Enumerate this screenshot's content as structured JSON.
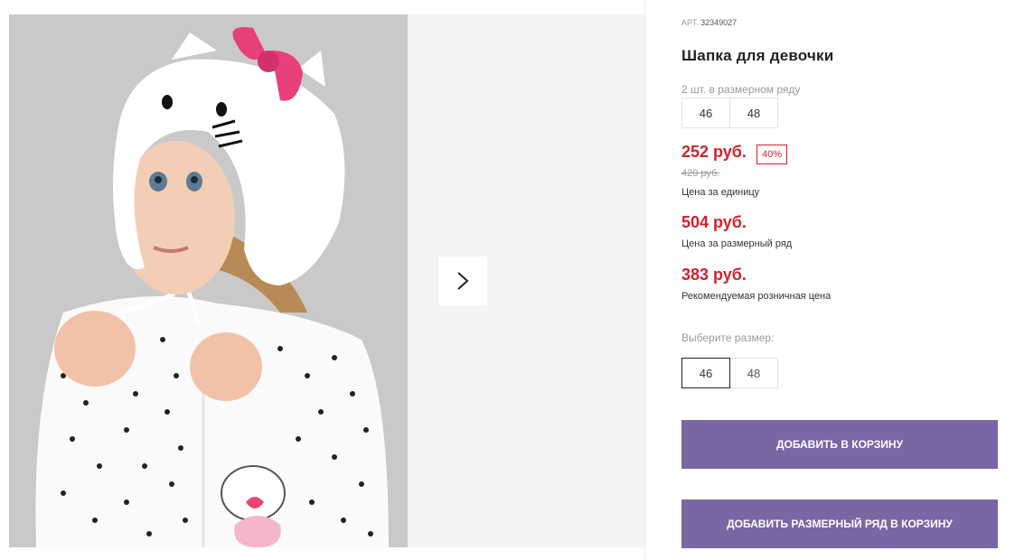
{
  "product": {
    "sku_label": "АРТ.",
    "sku_value": "32349027",
    "title": "Шапка для девочки"
  },
  "pack": {
    "caption": "2 шт. в размерном ряду",
    "sizes": [
      "46",
      "48"
    ]
  },
  "pricing": {
    "unit_price": "252 руб.",
    "discount": "40%",
    "old_price": "420 руб.",
    "unit_caption": "Цена за единицу",
    "row_price": "504 руб.",
    "row_caption": "Цена за размерный ряд",
    "retail_price": "383 руб.",
    "retail_caption": "Рекомендуемая розничная цена"
  },
  "size_select": {
    "label": "Выберите размер:",
    "options": [
      "46",
      "48"
    ],
    "selected": "46"
  },
  "actions": {
    "add_to_cart": "ДОБАВИТЬ В КОРЗИНУ",
    "add_row_to_cart": "ДОБАВИТЬ РАЗМЕРНЫЙ РЯД В КОРЗИНУ"
  },
  "gallery": {
    "next_icon": "chevron-right-icon"
  },
  "colors": {
    "price_red": "#d0232e",
    "button_purple": "#7a66a3",
    "photo_backdrop": "#c7c7c7",
    "gallery_bg": "#f4f4f4"
  }
}
